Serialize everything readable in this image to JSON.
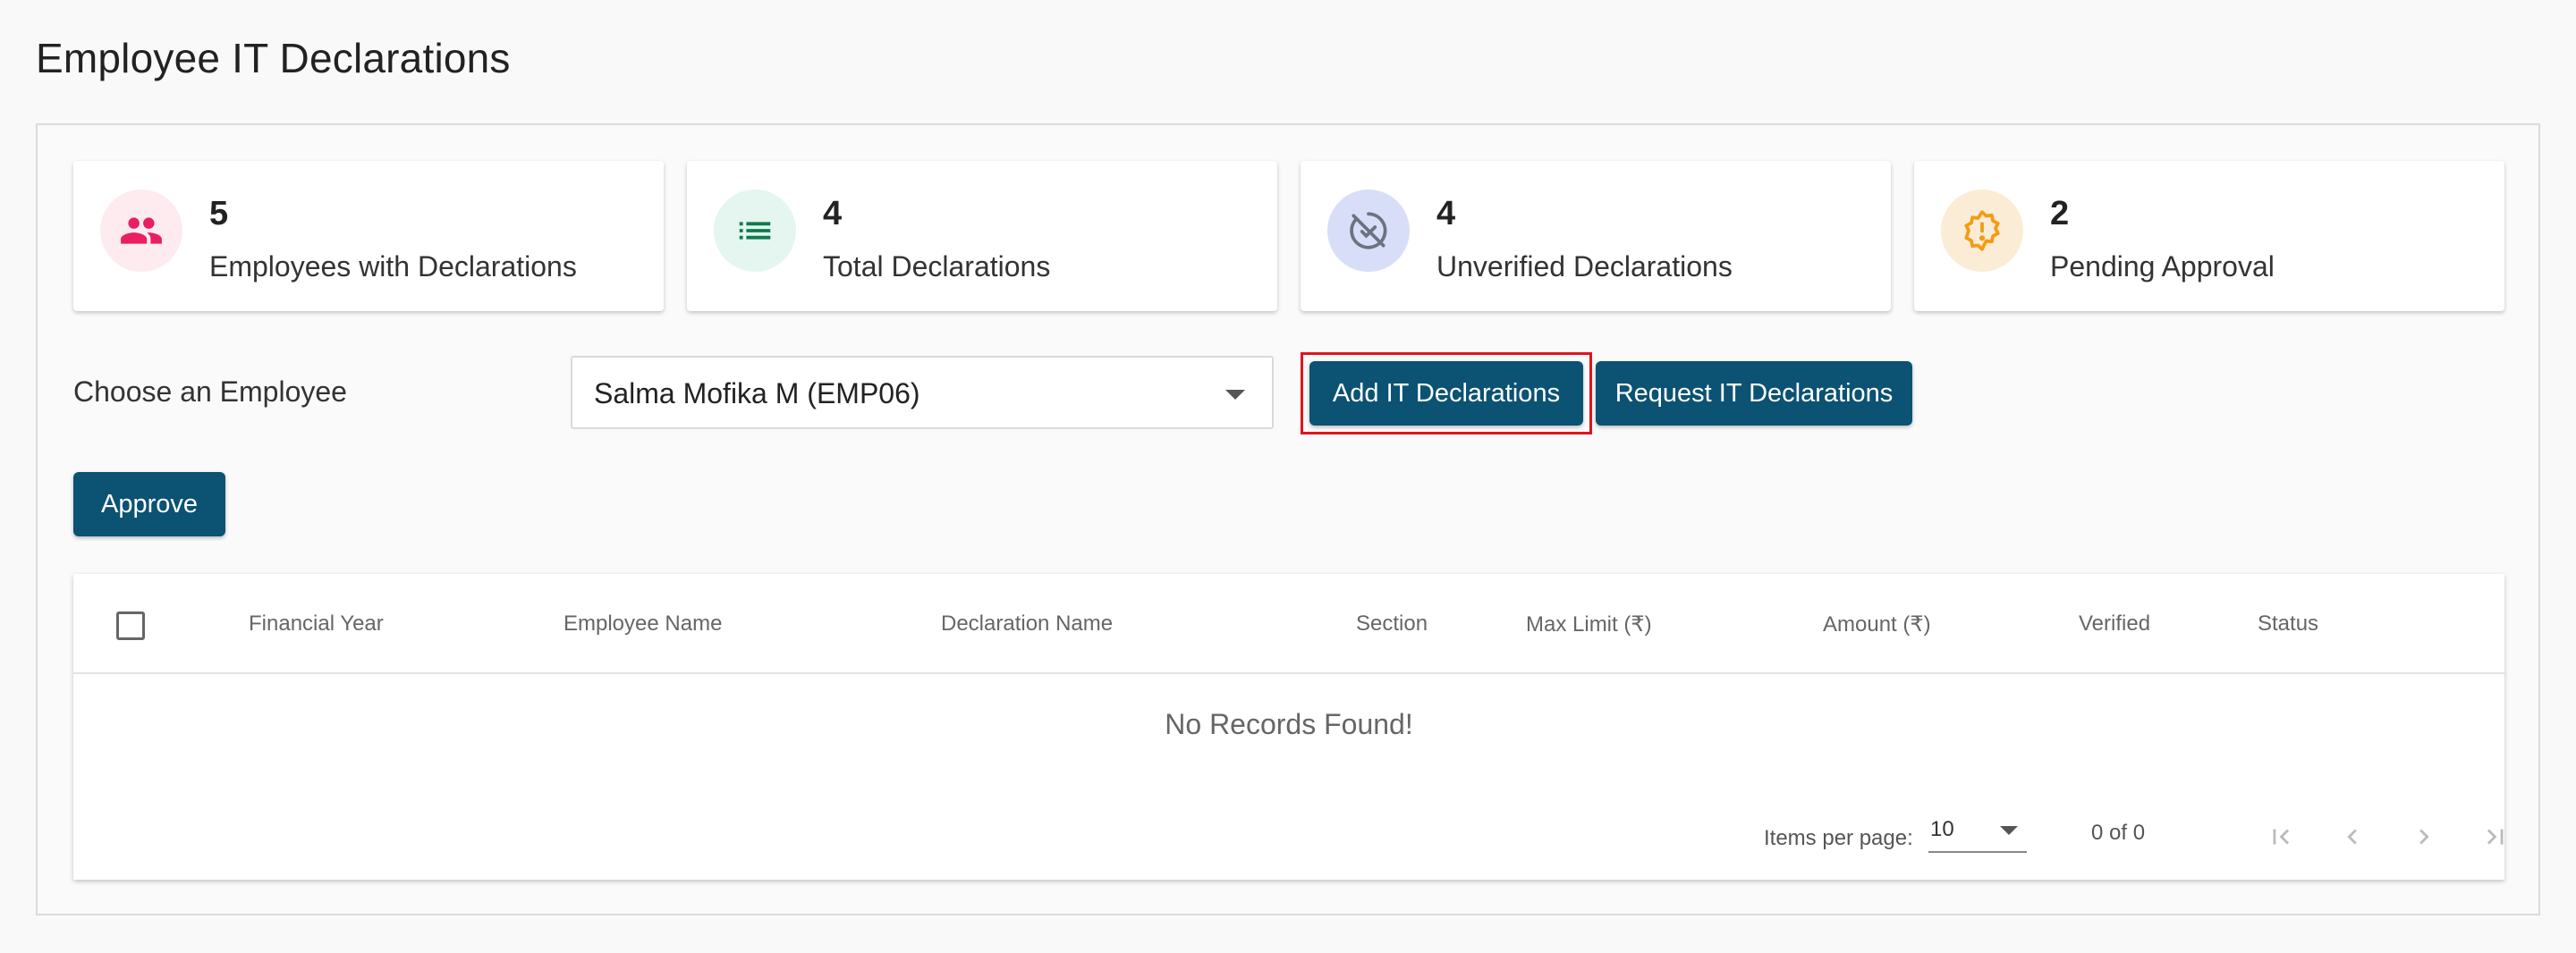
{
  "page": {
    "title": "Employee IT Declarations"
  },
  "stats": [
    {
      "count": "5",
      "label": "Employees with Declarations",
      "icon": "people-icon",
      "color": "#e91e63",
      "bg": "#fdebf0"
    },
    {
      "count": "4",
      "label": "Total Declarations",
      "icon": "list-icon",
      "color": "#0f7a4f",
      "bg": "#e4f6ef"
    },
    {
      "count": "4",
      "label": "Unverified Declarations",
      "icon": "unverified-icon",
      "color": "#6b7280",
      "bg": "#d9def8"
    },
    {
      "count": "2",
      "label": "Pending Approval",
      "icon": "pending-icon",
      "color": "#f39c12",
      "bg": "#fbecd6"
    }
  ],
  "filter": {
    "label": "Choose an Employee",
    "selected": "Salma Mofika M (EMP06)"
  },
  "buttons": {
    "add": "Add IT Declarations",
    "request": "Request IT Declarations",
    "approve": "Approve"
  },
  "table": {
    "columns": [
      "Financial Year",
      "Employee Name",
      "Declaration Name",
      "Section",
      "Max Limit (₹)",
      "Amount (₹)",
      "Verified",
      "Status"
    ],
    "empty": "No Records Found!"
  },
  "paginator": {
    "items_per_page_label": "Items per page:",
    "page_size": "10",
    "range": "0 of 0"
  },
  "colors": {
    "primary": "#0b5273",
    "highlight": "#e0141e"
  }
}
